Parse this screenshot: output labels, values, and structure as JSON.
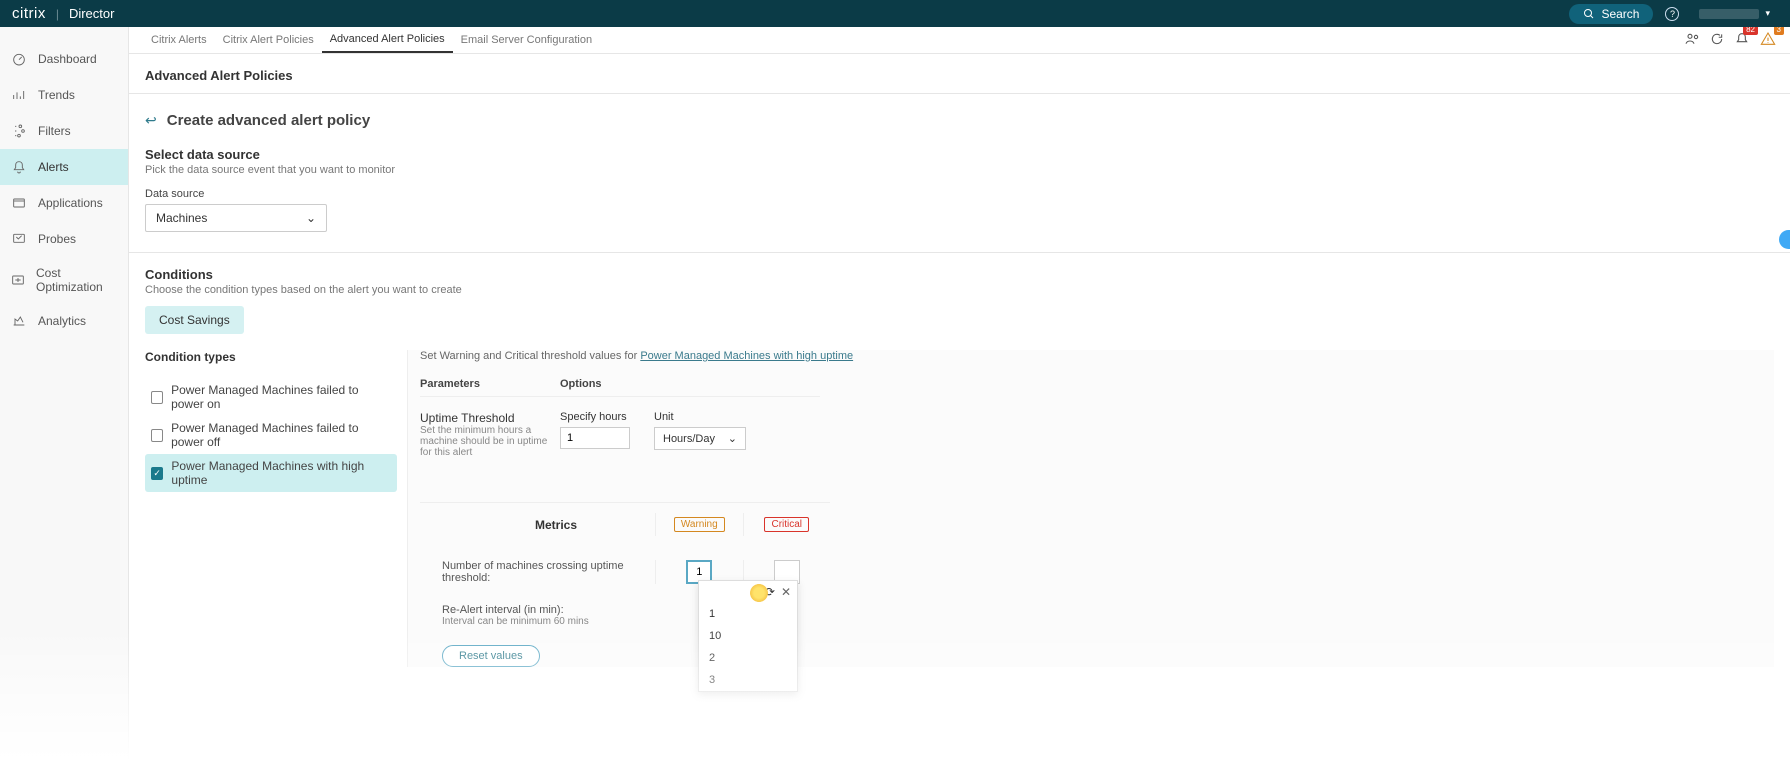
{
  "header": {
    "brand": "citrix",
    "app": "Director",
    "search_label": "Search",
    "badge_notifications": "82",
    "badge_warnings": "3"
  },
  "sidebar": {
    "items": [
      {
        "label": "Dashboard"
      },
      {
        "label": "Trends"
      },
      {
        "label": "Filters"
      },
      {
        "label": "Alerts"
      },
      {
        "label": "Applications"
      },
      {
        "label": "Probes"
      },
      {
        "label": "Cost Optimization"
      },
      {
        "label": "Analytics"
      }
    ]
  },
  "tabs": {
    "items": [
      "Citrix Alerts",
      "Citrix Alert Policies",
      "Advanced Alert Policies",
      "Email Server Configuration"
    ]
  },
  "page": {
    "title": "Advanced Alert Policies",
    "create_title": "Create advanced alert policy"
  },
  "datasource": {
    "title": "Select data source",
    "desc": "Pick the data source event that you want to monitor",
    "label": "Data source",
    "value": "Machines"
  },
  "conditions": {
    "title": "Conditions",
    "desc": "Choose the condition types based on the alert you want to create",
    "cost_savings": "Cost Savings",
    "types_title": "Condition types",
    "types": [
      {
        "label": "Power Managed Machines failed to power on",
        "checked": false
      },
      {
        "label": "Power Managed Machines failed to power off",
        "checked": false
      },
      {
        "label": "Power Managed Machines with high uptime",
        "checked": true
      }
    ]
  },
  "threshold": {
    "intro_prefix": "Set Warning and Critical threshold values for ",
    "intro_link": "Power Managed Machines with high uptime",
    "col_parameters": "Parameters",
    "col_options": "Options",
    "uptime_title": "Uptime Threshold",
    "uptime_note": "Set the minimum hours a machine should be in uptime for this alert",
    "specify_label": "Specify hours",
    "specify_value": "1",
    "unit_label": "Unit",
    "unit_value": "Hours/Day",
    "metrics_label": "Metrics",
    "warning_tag": "Warning",
    "critical_tag": "Critical",
    "metric_row_label": "Number of machines crossing uptime threshold:",
    "warning_value": "1",
    "critical_value": "",
    "realert_label": "Re-Alert interval (in min):",
    "realert_note": "Interval can be minimum 60 mins",
    "reset_label": "Reset values"
  },
  "dropdown": {
    "items": [
      "1",
      "10",
      "2",
      "3"
    ]
  }
}
